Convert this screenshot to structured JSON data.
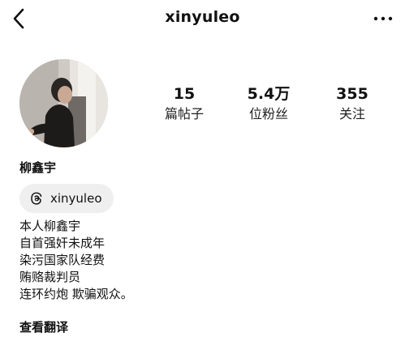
{
  "header": {
    "username": "xinyuleo",
    "back_icon": "chevron-left-icon",
    "more_icon": "more-horizontal-icon"
  },
  "profile": {
    "stats": [
      {
        "value": "15",
        "label": "篇帖子"
      },
      {
        "value": "5.4万",
        "label": "位粉丝"
      },
      {
        "value": "355",
        "label": "关注"
      }
    ],
    "display_name": "柳鑫宇",
    "threads_handle": "xinyuleo",
    "threads_icon": "threads-icon",
    "bio_lines": [
      "本人柳鑫宇",
      "自首强奸未成年",
      "染污国家队经费",
      "贿赂裁判员",
      "连环约炮 欺骗观众。"
    ],
    "see_translation": "查看翻译"
  },
  "colors": {
    "text": "#111111",
    "pill_background": "#efefef"
  }
}
